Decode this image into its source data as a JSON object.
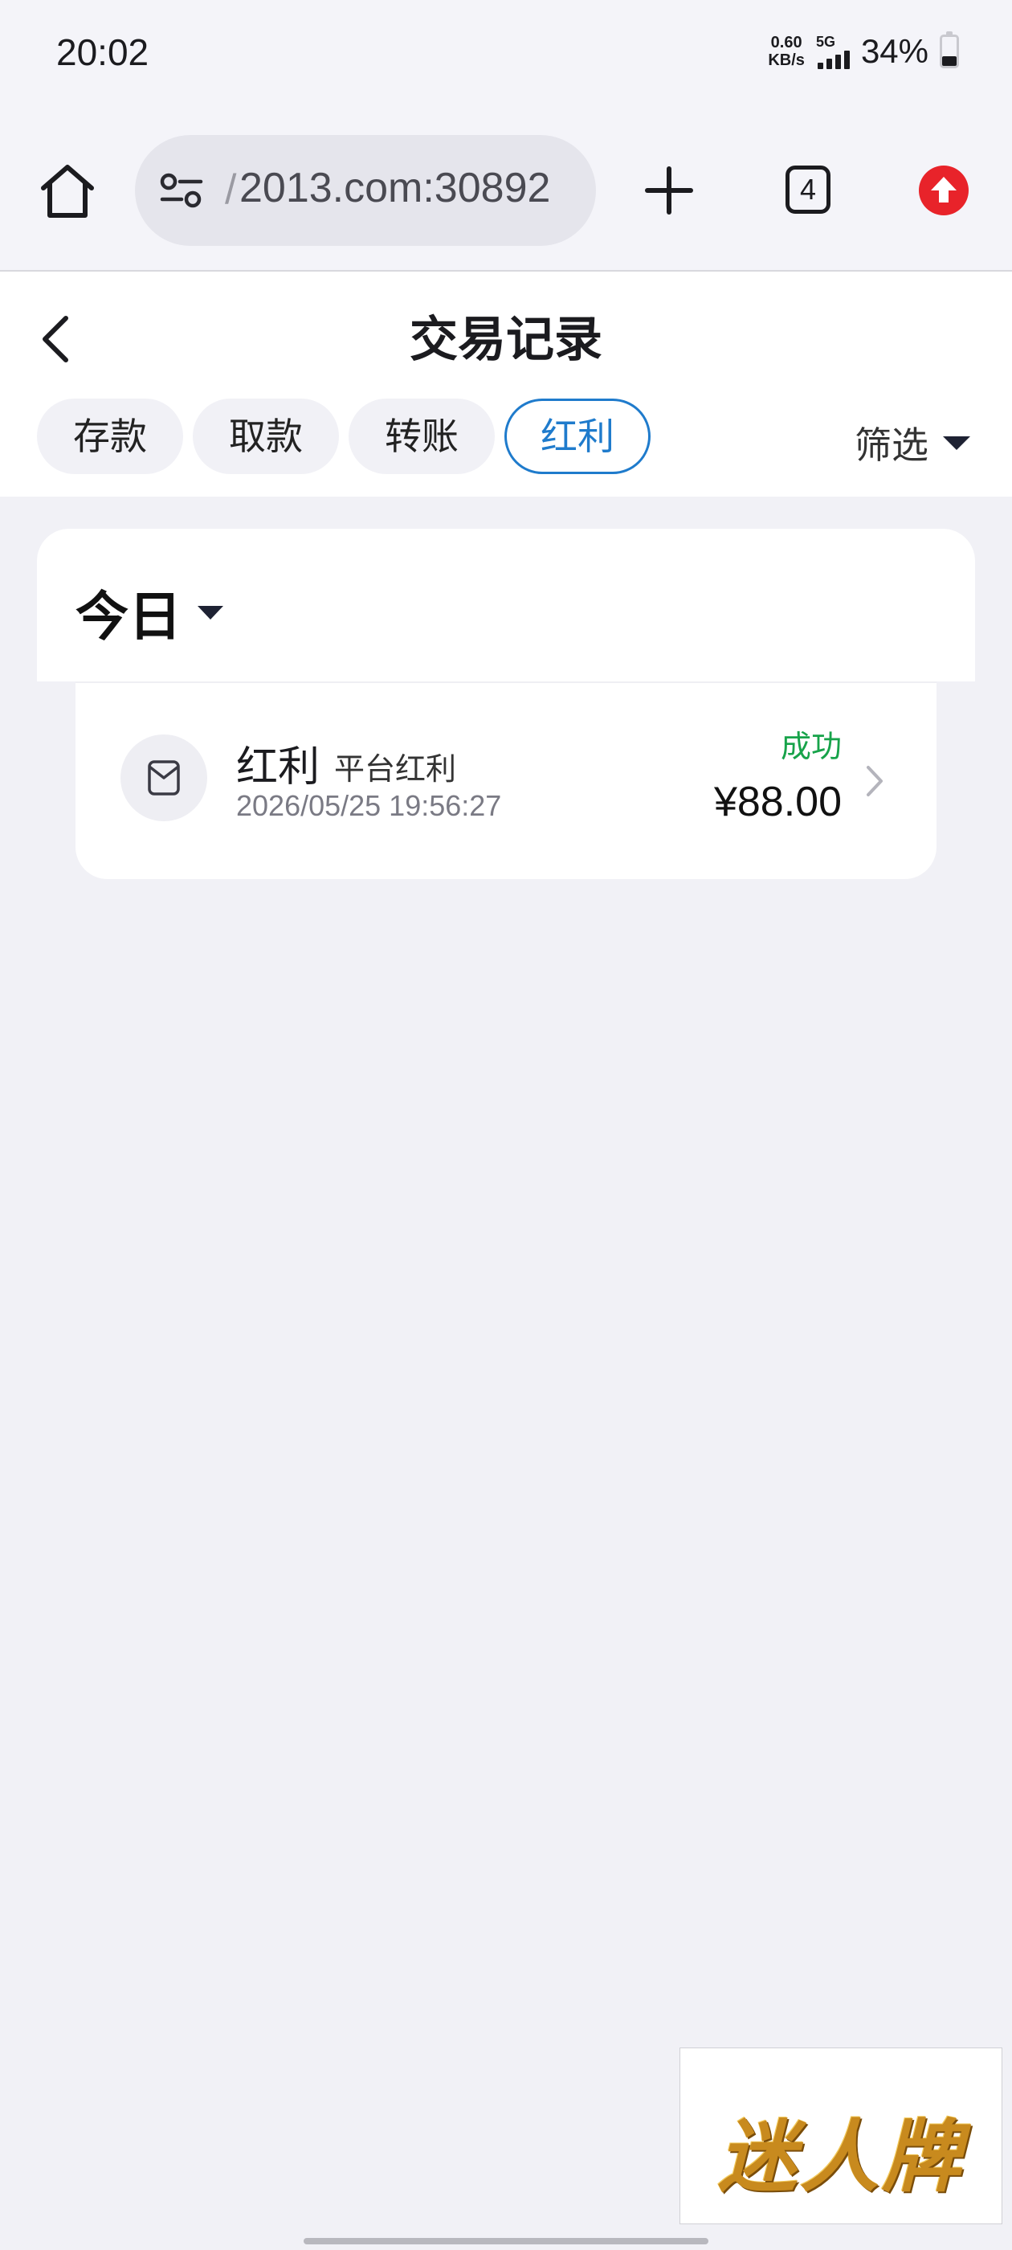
{
  "status_bar": {
    "time": "20:02",
    "net_speed_value": "0.60",
    "net_speed_unit": "KB/s",
    "network_type": "5G",
    "battery_percent": "34%",
    "battery_level": 0.34
  },
  "browser": {
    "url_prefix": "/",
    "url": "2013.com:30892",
    "tab_count": "4",
    "icons": {
      "home": "home-icon",
      "site_settings": "tune-icon",
      "new_tab": "plus-icon",
      "update": "arrow-up-icon"
    },
    "update_color": "#e8232a"
  },
  "header": {
    "title": "交易记录",
    "back_icon": "chevron-left-icon"
  },
  "tabs": [
    {
      "label": "存款",
      "active": false
    },
    {
      "label": "取款",
      "active": false
    },
    {
      "label": "转账",
      "active": false
    },
    {
      "label": "红利",
      "active": true
    }
  ],
  "filter": {
    "label": "筛选"
  },
  "period": {
    "label": "今日"
  },
  "transactions": [
    {
      "icon": "wallet-icon",
      "type": "红利",
      "subtype": "平台红利",
      "time": "2026/05/25 19:56:27",
      "status": "成功",
      "amount": "¥88.00"
    }
  ],
  "watermark": {
    "text": "迷人牌"
  },
  "colors": {
    "accent": "#1f7bcc",
    "success": "#17a34a",
    "background": "#f1f1f6"
  }
}
